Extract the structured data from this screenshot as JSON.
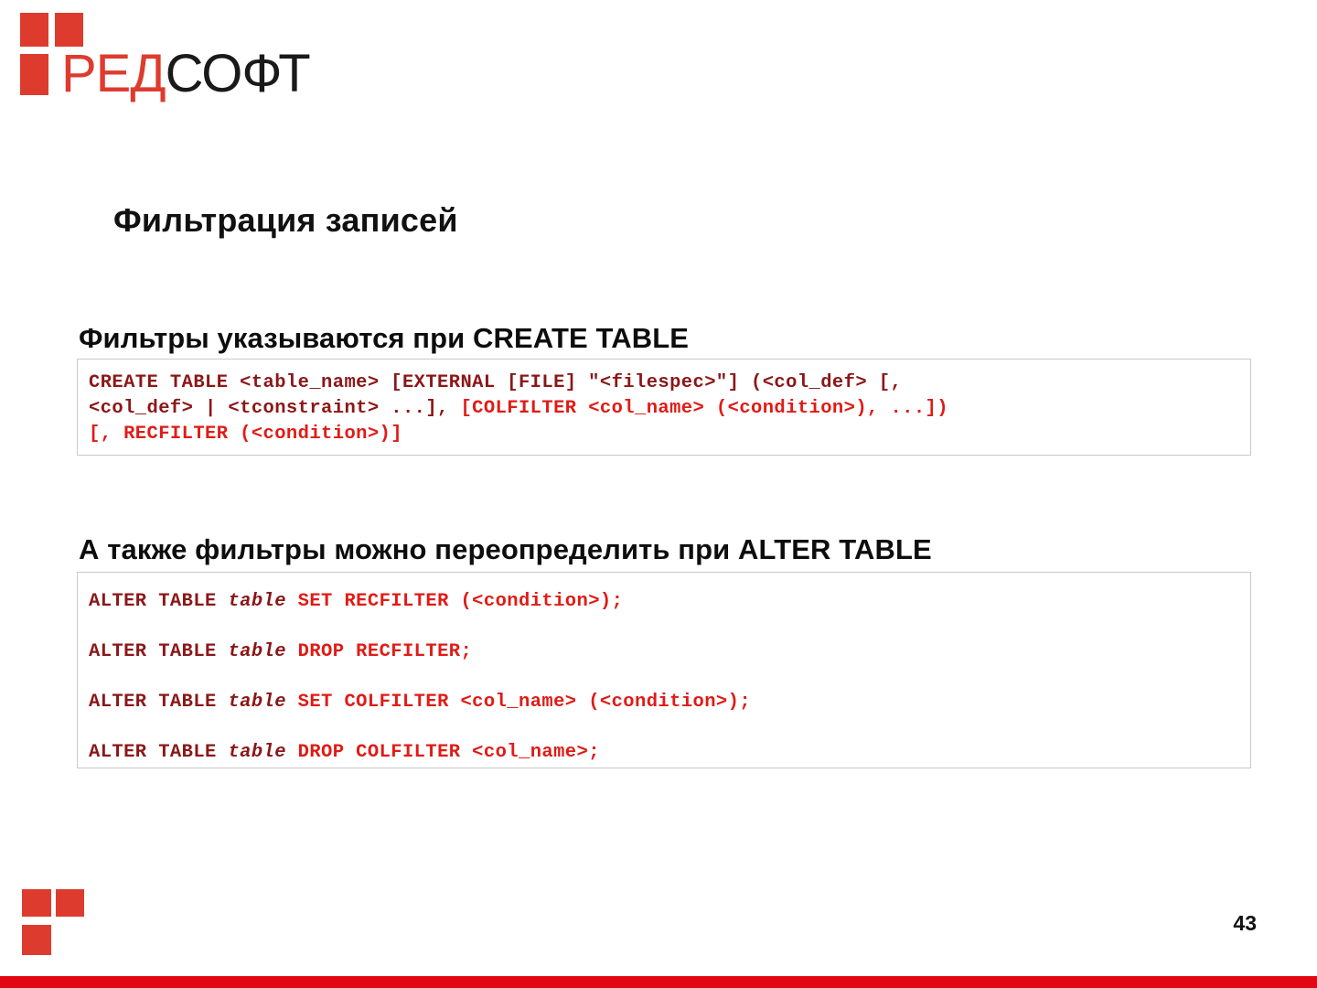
{
  "brand": {
    "name_red": "РЕД",
    "name_dark": "СОФТ"
  },
  "slide": {
    "title": "Фильтрация записей",
    "page_number": "43"
  },
  "sections": {
    "create": {
      "heading": "Фильтры указываются при CREATE TABLE",
      "code_lines": [
        {
          "tokens": [
            {
              "text": "CREATE TABLE <table_name> [EXTERNAL [FILE] \"<filespec>\"] (<col_def> [,",
              "style": "dark"
            }
          ]
        },
        {
          "tokens": [
            {
              "text": "<col_def> | <tconstraint> ...], ",
              "style": "dark"
            },
            {
              "text": "[COLFILTER <col_name> (<condition>), ...])",
              "style": "red"
            }
          ]
        },
        {
          "tokens": [
            {
              "text": "[, RECFILTER (<condition>)]",
              "style": "red"
            }
          ]
        }
      ]
    },
    "alter": {
      "heading": "А также фильтры можно переопределить при ALTER TABLE",
      "code_lines": [
        {
          "tokens": [
            {
              "text": "ALTER TABLE ",
              "style": "dark"
            },
            {
              "text": "table",
              "style": "italic"
            },
            {
              "text": " ",
              "style": "dark"
            },
            {
              "text": "SET RECFILTER (<condition>);",
              "style": "red"
            }
          ]
        },
        {
          "tokens": [
            {
              "text": "ALTER TABLE ",
              "style": "dark"
            },
            {
              "text": "table",
              "style": "italic"
            },
            {
              "text": " ",
              "style": "dark"
            },
            {
              "text": "DROP RECFILTER;",
              "style": "red"
            }
          ]
        },
        {
          "tokens": [
            {
              "text": "ALTER TABLE ",
              "style": "dark"
            },
            {
              "text": "table",
              "style": "italic"
            },
            {
              "text": " ",
              "style": "dark"
            },
            {
              "text": "SET COLFILTER <col_name> (<condition>);",
              "style": "red"
            }
          ]
        },
        {
          "tokens": [
            {
              "text": "ALTER TABLE ",
              "style": "dark"
            },
            {
              "text": "table",
              "style": "italic"
            },
            {
              "text": " ",
              "style": "dark"
            },
            {
              "text": "DROP COLFILTER <col_name>;",
              "style": "red"
            }
          ]
        }
      ]
    }
  },
  "colors": {
    "brand_red": "#DE3B2F",
    "bar_red": "#E30613",
    "code_dark_red": "#8B1718",
    "code_bright_red": "#E01B16",
    "code_border": "#c9c9c9"
  }
}
